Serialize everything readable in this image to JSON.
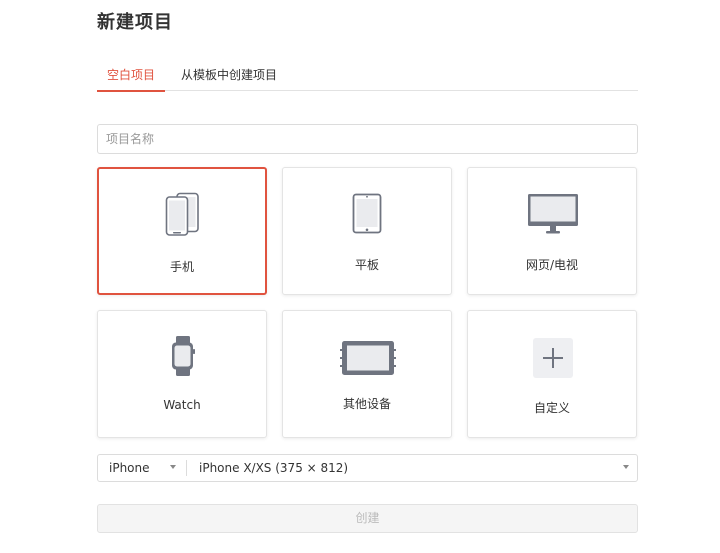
{
  "page": {
    "title": "新建项目"
  },
  "tabs": [
    {
      "label": "空白项目",
      "active": true
    },
    {
      "label": "从模板中创建项目",
      "active": false
    }
  ],
  "project_name": {
    "value": "",
    "placeholder": "项目名称"
  },
  "devices": [
    {
      "label": "手机",
      "icon": "phone-icon",
      "selected": true
    },
    {
      "label": "平板",
      "icon": "tablet-icon",
      "selected": false
    },
    {
      "label": "网页/电视",
      "icon": "monitor-icon",
      "selected": false
    },
    {
      "label": "Watch",
      "icon": "watch-icon",
      "selected": false
    },
    {
      "label": "其他设备",
      "icon": "other-device-icon",
      "selected": false
    },
    {
      "label": "自定义",
      "icon": "plus-icon",
      "selected": false
    }
  ],
  "selector": {
    "device": "iPhone",
    "model": "iPhone X/XS (375 × 812)"
  },
  "create_button": {
    "label": "创建",
    "disabled": true
  },
  "colors": {
    "accent": "#e0533f",
    "icon": "#6f7480",
    "border": "#e4e4e4"
  }
}
